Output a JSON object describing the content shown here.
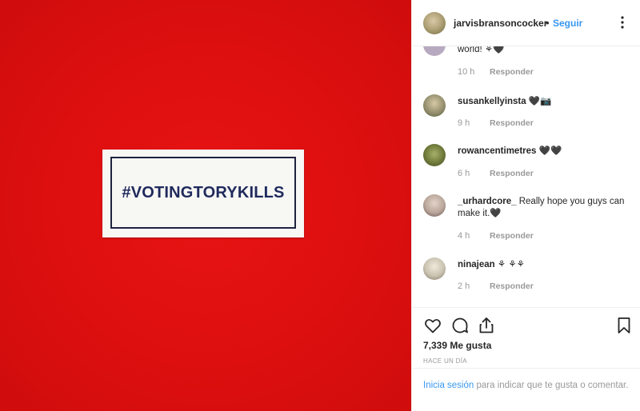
{
  "photo": {
    "sticker_text": "#VOTINGTORYKILLS",
    "background_color": "#e01010"
  },
  "header": {
    "username": "jarvisbransoncocker",
    "separator": "•",
    "follow_label": "Seguir",
    "more_icon": "more-options-icon"
  },
  "comments": [
    {
      "username": "",
      "text": "world! ⚘🖤",
      "time": "10 h",
      "reply_label": "Responder",
      "avatar_color": "#b7a9c0"
    },
    {
      "username": "susankellyinsta",
      "text": "🖤📷",
      "time": "9 h",
      "reply_label": "Responder",
      "avatar_color": "#8f8a6a"
    },
    {
      "username": "rowancentimetres",
      "text": "🖤🖤",
      "time": "6 h",
      "reply_label": "Responder",
      "avatar_color": "#6f7a3a"
    },
    {
      "username": "_urhardcore_",
      "text": "Really hope you guys can make it.🖤",
      "time": "4 h",
      "reply_label": "Responder",
      "avatar_color": "#b9a59a"
    },
    {
      "username": "ninajean",
      "text": "⚘ ⚘⚘",
      "time": "2 h",
      "reply_label": "Responder",
      "avatar_color": "#c9c2b0"
    }
  ],
  "actions": {
    "like_icon": "heart-icon",
    "comment_icon": "comment-icon",
    "share_icon": "share-icon",
    "save_icon": "bookmark-icon",
    "likes_text": "7,339 Me gusta",
    "time_ago": "HACE UN DÍA"
  },
  "footer": {
    "login_link": "Inicia sesión",
    "login_text": " para indicar que te gusta o comentar."
  }
}
